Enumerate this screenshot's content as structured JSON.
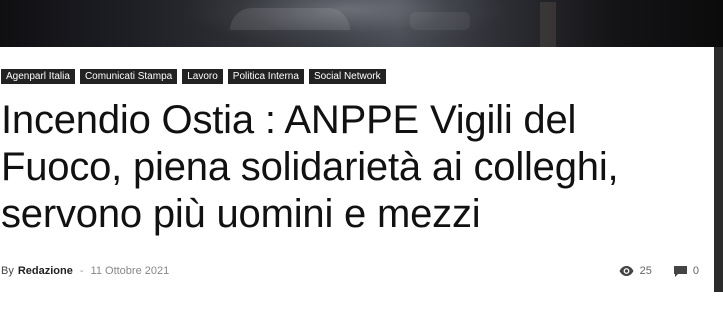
{
  "categories": [
    {
      "label": "Agenparl Italia"
    },
    {
      "label": "Comunicati Stampa"
    },
    {
      "label": "Lavoro"
    },
    {
      "label": "Politica Interna"
    },
    {
      "label": "Social Network"
    }
  ],
  "article": {
    "title": "Incendio Ostia : ANPPE Vigili del Fuoco, piena solidarietà ai colleghi, servono più uomini e mezzi",
    "by_label": "By",
    "author": "Redazione",
    "separator": "-",
    "date": "11 Ottobre 2021",
    "views": "25",
    "comments": "0"
  },
  "icons": {
    "views": "eye-icon",
    "comments": "comment-icon"
  }
}
